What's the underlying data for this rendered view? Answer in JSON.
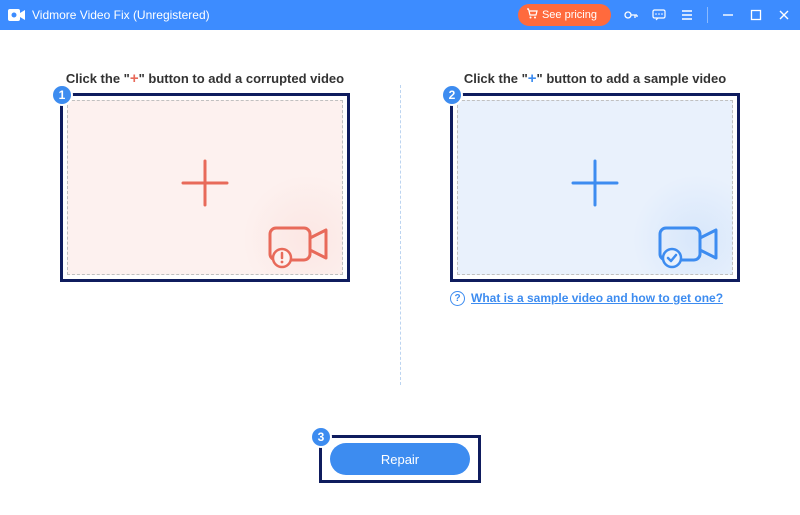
{
  "titlebar": {
    "title": "Vidmore Video Fix (Unregistered)",
    "pricing_label": "See pricing"
  },
  "colors": {
    "accent_blue": "#3d8cf0",
    "accent_red": "#e86a5a",
    "header_blue": "#3d8cff",
    "pricing_orange": "#ff6a3d",
    "badge_border": "#0f1c5e"
  },
  "steps": {
    "corrupted": {
      "badge": "1",
      "instruction_pre": "Click the \"",
      "instruction_plus": "+",
      "instruction_post": "\" button to add a corrupted video"
    },
    "sample": {
      "badge": "2",
      "instruction_pre": "Click the \"",
      "instruction_plus": "+",
      "instruction_post": "\" button to add a sample video",
      "help_text": "What is a sample video and how to get one?"
    },
    "repair": {
      "badge": "3",
      "button_label": "Repair"
    }
  }
}
